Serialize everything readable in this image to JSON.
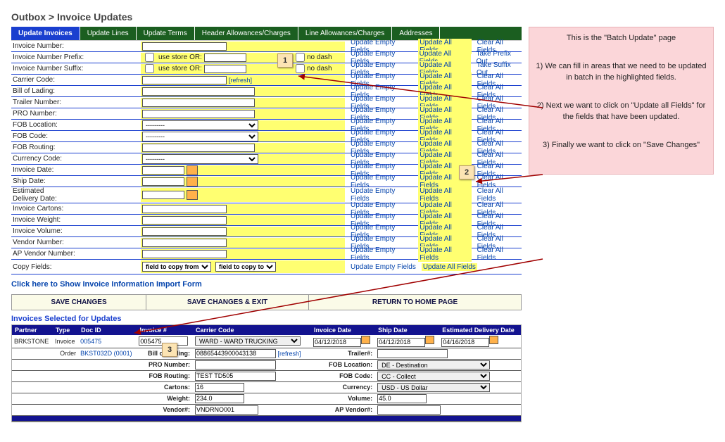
{
  "breadcrumb": "Outbox > Invoice Updates",
  "tabs": [
    "Update Invoices",
    "Update Lines",
    "Update Terms",
    "Header Allowances/Charges",
    "Line Allowances/Charges",
    "Addresses"
  ],
  "linkLabels": {
    "updEmpty": "Update Empty Fields",
    "updAll": "Update All Fields",
    "clearAll": "Clear All Fields",
    "prefixOut": "Take Prefix Out",
    "suffixOut": "Take Suffix Out"
  },
  "rows": {
    "invNum": "Invoice Number:",
    "prefix": "Invoice Number Prefix:",
    "suffix": "Invoice Number Suffix:",
    "carrier": "Carrier Code:",
    "bol": "Bill of Lading:",
    "trailer": "Trailer Number:",
    "pro": "PRO Number:",
    "fobLoc": "FOB Location:",
    "fobCode": "FOB Code:",
    "fobRoute": "FOB Routing:",
    "currency": "Currency Code:",
    "invDate": "Invoice Date:",
    "shipDate": "Ship Date:",
    "estDeliv": "Estimated\nDelivery Date:",
    "cartons": "Invoice Cartons:",
    "weight": "Invoice Weight:",
    "volume": "Invoice Volume:",
    "vendor": "Vendor Number:",
    "apVendor": "AP Vendor Number:",
    "copy": "Copy Fields:"
  },
  "useStore": "use store",
  "or": "OR:",
  "noDash": "no dash",
  "refresh": "[refresh]",
  "dashSelect": "---------",
  "copyFrom": "field to copy from",
  "copyTo": "field to copy to",
  "importLink": "Click here to Show Invoice Information Import Form",
  "actions": {
    "save": "SAVE CHANGES",
    "saveExit": "SAVE CHANGES & EXIT",
    "home": "RETURN TO HOME PAGE"
  },
  "selectedTitle": "Invoices Selected for Updates",
  "gridHead": [
    "Partner",
    "Type",
    "Doc ID",
    "Invoice #",
    "Carrier Code",
    "Invoice Date",
    "Ship Date",
    "Estimated Delivery Date"
  ],
  "gridRow1": {
    "partner": "BRKSTONE",
    "type": "Invoice",
    "docId": "005475",
    "invNum": "005475",
    "carrier": "WARD - WARD TRUCKING",
    "invDate": "04/12/2018",
    "shipDate": "04/12/2018",
    "estDate": "04/16/2018"
  },
  "order": "Order",
  "orderId": "BKST032D (0001)",
  "subLabels": {
    "bol": "Bill of Lading:",
    "trailer": "Trailer#:",
    "pro": "PRO Number:",
    "fobLoc": "FOB Location:",
    "fobRoute": "FOB Routing:",
    "fobCode": "FOB Code:",
    "cartons": "Cartons:",
    "currency": "Currency:",
    "weight": "Weight:",
    "volume": "Volume:",
    "vendor": "Vendor#:",
    "apVendor": "AP Vendor#:"
  },
  "subVals": {
    "bol": "08865443900043138",
    "pro": "",
    "fobLoc": "DE - Destination",
    "fobRoute": "TEST TD505",
    "fobCode": "CC - Collect",
    "cartons": "16",
    "currency": "USD - US Dollar",
    "weight": "234.0",
    "volume": "45.0",
    "vendor": "VNDRNO001",
    "apVendor": ""
  },
  "notes": {
    "title": "This is the \"Batch Update\" page",
    "n1": "1) We can fill in areas that we need to be updated in batch in the highlighted fields.",
    "n2": "2) Next we want to click on \"Update all Fields\" for the fields that have been updated.",
    "n3": "3) Finally we want to click on \"Save Changes\""
  },
  "callouts": {
    "c1": "1",
    "c2": "2",
    "c3": "3"
  }
}
